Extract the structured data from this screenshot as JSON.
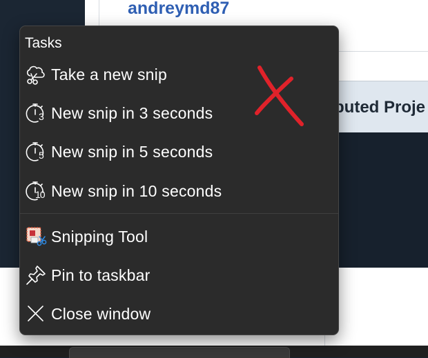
{
  "background": {
    "username": "andreymd87",
    "project_text": "buted Proje"
  },
  "jumplist": {
    "section_title": "Tasks",
    "tasks": [
      {
        "label": "Take a new snip",
        "icon": "snip-icon"
      },
      {
        "label": "New snip in 3 seconds",
        "icon": "timer-3-icon",
        "timer_digit": "3"
      },
      {
        "label": "New snip in 5 seconds",
        "icon": "timer-5-icon",
        "timer_digit": "5"
      },
      {
        "label": "New snip in 10 seconds",
        "icon": "timer-10-icon",
        "timer_digit": "10"
      }
    ],
    "app_items": [
      {
        "label": "Snipping Tool",
        "icon": "snipping-tool-app-icon"
      },
      {
        "label": "Pin to taskbar",
        "icon": "pin-icon"
      },
      {
        "label": "Close window",
        "icon": "close-icon"
      }
    ]
  },
  "colors": {
    "menu_bg": "#2b2b2b",
    "annotation": "#e0222a",
    "username": "#2f5fb3"
  }
}
